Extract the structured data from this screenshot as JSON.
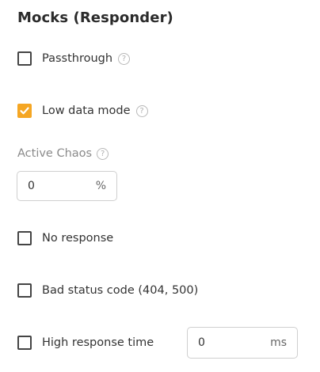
{
  "title": "Mocks (Responder)",
  "help_glyph": "?",
  "options": {
    "passthrough": {
      "label": "Passthrough",
      "checked": false
    },
    "low_data_mode": {
      "label": "Low data mode",
      "checked": true
    },
    "no_response": {
      "label": "No response",
      "checked": false
    },
    "bad_status_code": {
      "label": "Bad status code (404, 500)",
      "checked": false
    },
    "high_response_time": {
      "label": "High response time",
      "checked": false
    }
  },
  "active_chaos": {
    "label": "Active Chaos",
    "value": "0",
    "unit": "%"
  },
  "response_time": {
    "value": "0",
    "unit": "ms"
  },
  "colors": {
    "accent": "#f5a623",
    "help_icon": "#b8b8b8",
    "muted_label": "#8a8a8a"
  }
}
